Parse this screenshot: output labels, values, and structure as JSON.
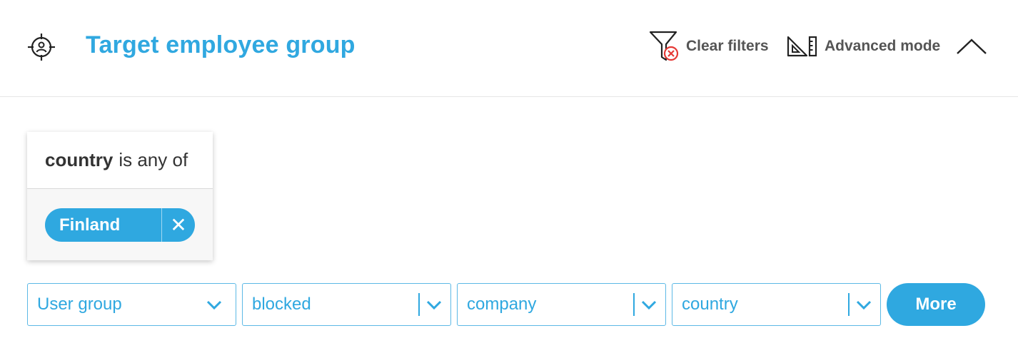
{
  "header": {
    "title": "Target employee group",
    "icon": "target-user-icon",
    "actions": {
      "clear_filters_label": "Clear filters",
      "clear_filters_icon": "filter-clear-icon",
      "advanced_mode_label": "Advanced mode",
      "advanced_mode_icon": "set-square-ruler-icon",
      "collapse_icon": "chevron-up-icon"
    }
  },
  "filter_card": {
    "key": "country",
    "operator": "is any of",
    "chips": [
      {
        "label": "Finland",
        "remove_icon": "close-icon"
      }
    ]
  },
  "selects": [
    {
      "value": "User group"
    },
    {
      "value": "blocked"
    },
    {
      "value": "company"
    },
    {
      "value": "country"
    }
  ],
  "more_button": {
    "label": "More"
  },
  "colors": {
    "accent": "#2fa8e0",
    "title": "#30a8e0",
    "action_text": "#555555",
    "danger": "#e53935"
  }
}
